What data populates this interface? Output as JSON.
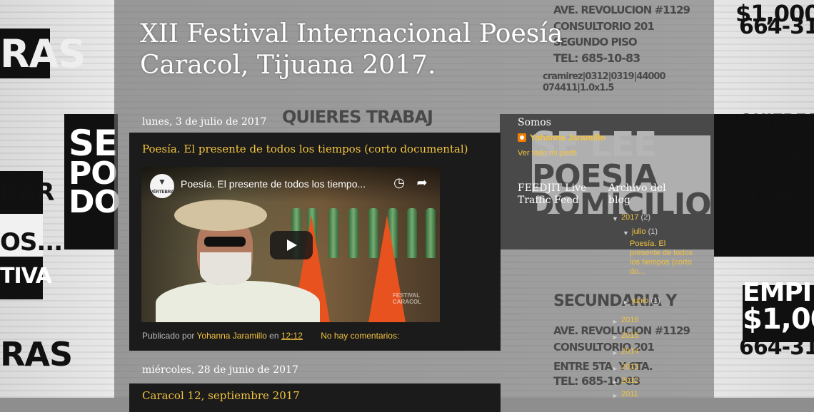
{
  "blog": {
    "title": "XII Festival Internacional Poesía Caracol, Tijuana 2017."
  },
  "posts": [
    {
      "date": "lunes, 3 de julio de 2017",
      "title": "Poesía. El presente de todos los tiempos (corto documental)",
      "video": {
        "channel": "VÉRTEBRA",
        "title": "Poesía. El presente de todos los tiempo...",
        "watermark": "FESTIVAL CARACOL"
      },
      "footer": {
        "published_by": "Publicado por",
        "author": "Yohanna Jaramillo",
        "at": "en",
        "time": "12:12",
        "comments": "No hay comentarios:"
      }
    },
    {
      "date": "miércoles, 28 de junio de 2017",
      "title": "Caracol 12, septiembre 2017"
    }
  ],
  "sidebar": {
    "somos": {
      "heading": "Somos",
      "name": "Yohanna Jaramillo",
      "link": "Ver todo mi perfil"
    },
    "feedjit": {
      "heading": "FEEDJIT Live Traffic Feed"
    },
    "archive": {
      "heading": "Archivo del blog",
      "years": [
        {
          "label": "2017",
          "count": "(2)",
          "expanded": true
        },
        {
          "label": "2016"
        },
        {
          "label": "2015"
        },
        {
          "label": "2014"
        },
        {
          "label": "2013"
        },
        {
          "label": "2012"
        },
        {
          "label": "2011"
        }
      ],
      "months": [
        {
          "label": "julio",
          "count": "(1)"
        },
        {
          "label": "junio",
          "count": "(1)"
        }
      ],
      "post": "Poesía. El presente de todos los tiempos (corto do..."
    }
  },
  "colors": {
    "accent": "#f2c33f",
    "post_bg": "#1b1b1b",
    "text": "#ffffff"
  }
}
